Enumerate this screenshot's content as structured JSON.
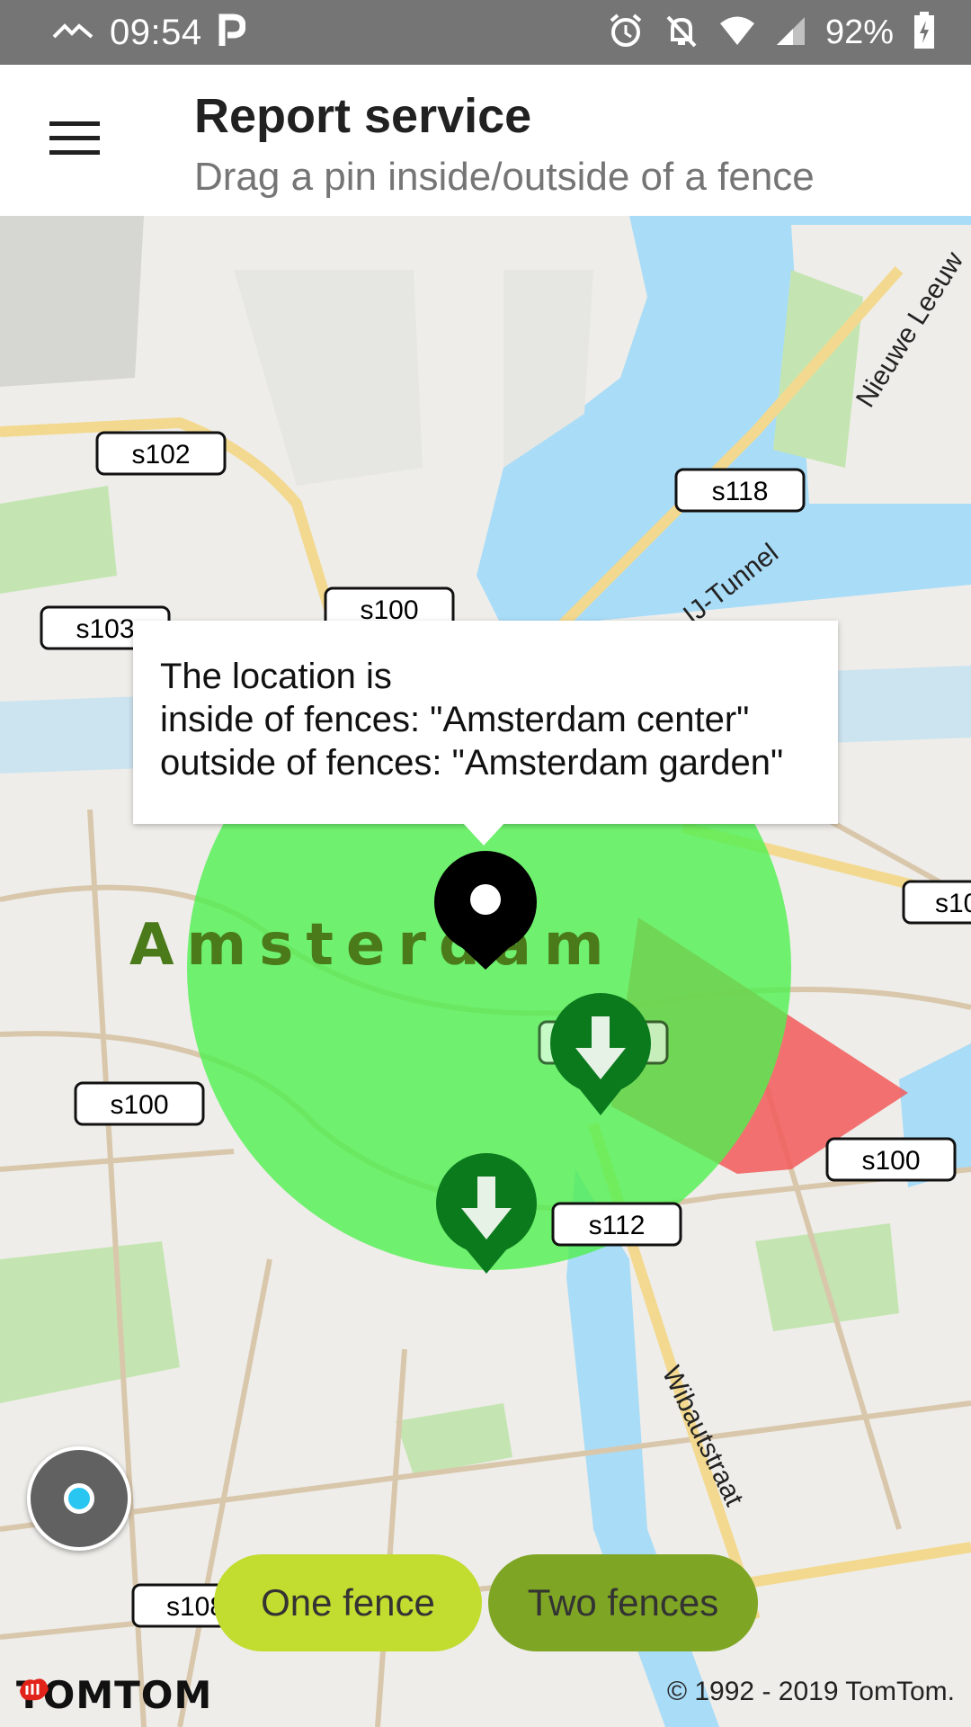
{
  "status_bar": {
    "time": "09:54",
    "battery": "92%",
    "icons": [
      "activity-icon",
      "parking-icon",
      "alarm-icon",
      "bell-off-icon",
      "wifi-icon",
      "signal-icon",
      "battery-icon"
    ]
  },
  "app_bar": {
    "menu_icon": "hamburger-menu-icon",
    "title": "Report service",
    "subtitle": "Drag a pin inside/outside of a fence"
  },
  "map": {
    "city_label": "Amsterdam",
    "road_labels": [
      "s102",
      "s118",
      "s103",
      "s100",
      "s100",
      "s100",
      "s10",
      "s112",
      "s116",
      "s108"
    ],
    "street_labels": [
      "IJ-Tunnel",
      "Nieuwe Leeuw",
      "Wibautstraat"
    ],
    "colors": {
      "water": "#a9dcf7",
      "land": "#eeede9",
      "park": "#c4e5b1",
      "road_main": "#f3d98f",
      "road_minor": "#d9c7ac",
      "fence_circle": "#4ff04f",
      "fence_polygon": "#f25a5a",
      "pin_black": "#000000",
      "pin_green": "#0b7a1d"
    }
  },
  "popup": {
    "line1": "The location is",
    "line2": "inside of fences: \"Amsterdam center\"",
    "line3": "outside of fences: \"Amsterdam garden\""
  },
  "buttons": {
    "one_fence": "One fence",
    "two_fences": "Two fences"
  },
  "footer": {
    "logo": "TOMTOM",
    "copyright": "© 1992 - 2019 TomTom."
  }
}
